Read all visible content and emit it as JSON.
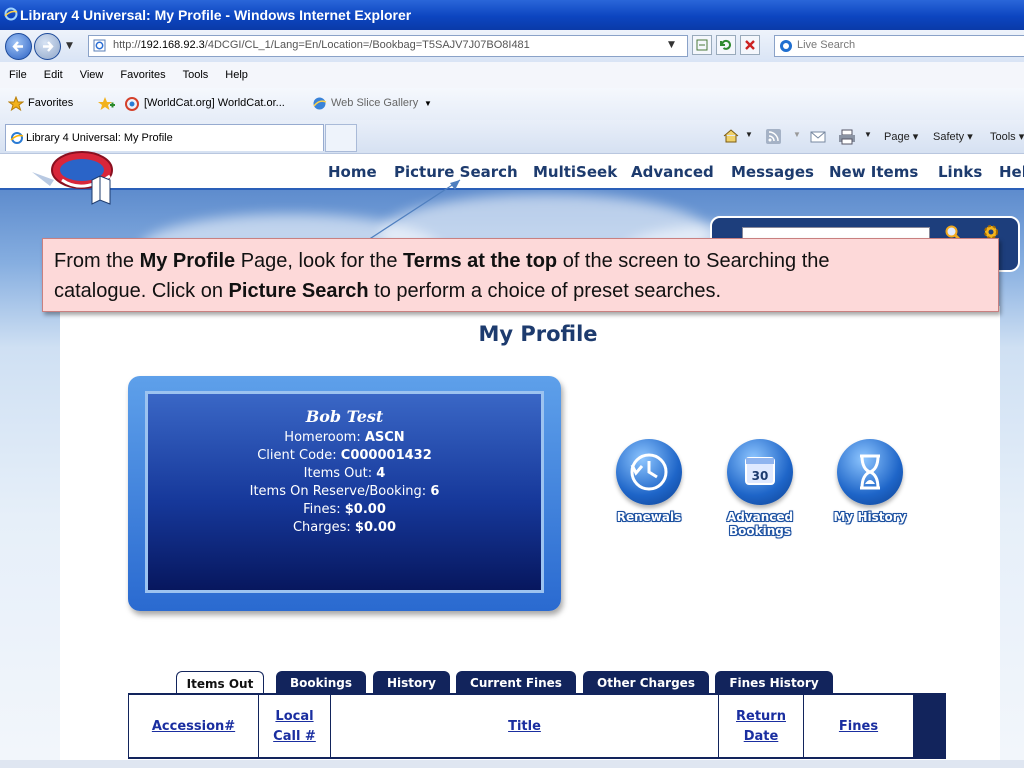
{
  "window": {
    "title": "Library 4 Universal: My Profile - Windows Internet Explorer",
    "url_prefix": "http://",
    "url_host": "192.168.92.3",
    "url_path": "/4DCGI/CL_1/Lang=En/Location=/Bookbag=T5SAJV7J07BO8I481",
    "search_placeholder": "Live Search"
  },
  "menu": [
    "File",
    "Edit",
    "View",
    "Favorites",
    "Tools",
    "Help"
  ],
  "favorites": {
    "favorites_label": "Favorites",
    "worldcat": "[WorldCat.org] WorldCat.or...",
    "slice_gallery": "Web Slice Gallery"
  },
  "browser_tab": {
    "label": "Library 4 Universal: My Profile",
    "commands": {
      "page": "Page",
      "safety": "Safety",
      "tools": "Tools"
    }
  },
  "site_nav": [
    "Home",
    "Picture Search",
    "MultiSeek",
    "Advanced",
    "Messages",
    "New Items",
    "Links",
    "Hel"
  ],
  "callout": {
    "l1_a": "From the ",
    "l1_b": "My Profile",
    "l1_c": " Page, look for  the ",
    "l1_d": "Terms  at the top",
    "l1_e": " of the screen to  Searching the",
    "l2_a": "catalogue.    Click on ",
    "l2_b": "Picture Search",
    "l2_c": " to perform a  choice of preset searches."
  },
  "page_title": "My Profile",
  "profile": {
    "name": "Bob Test",
    "homeroom_label": "Homeroom: ",
    "homeroom": "ASCN",
    "client_label": "Client Code: ",
    "client_code": "C000001432",
    "items_out_label": "Items Out: ",
    "items_out": "4",
    "reserve_label": "Items On Reserve/Booking: ",
    "reserve": "6",
    "fines_label": "Fines: ",
    "fines": "$0.00",
    "charges_label": "Charges: ",
    "charges": "$0.00"
  },
  "actions": {
    "renewals": "Renewals",
    "advanced_1": "Advanced",
    "advanced_2": "Bookings",
    "calendar_day": "30",
    "history": "My History"
  },
  "tabs": [
    "Items Out",
    "Bookings",
    "History",
    "Current Fines",
    "Other Charges",
    "Fines History"
  ],
  "table_headers": {
    "accession": "Accession#",
    "local_1": "Local",
    "local_2": "Call #",
    "title": "Title",
    "return_1": "Return",
    "return_2": "Date",
    "fines": "Fines"
  },
  "colors": {
    "titlebar": "#0c45c0",
    "nav_text": "#1d3b6e",
    "callout_bg": "#fdd9d9",
    "tab_dark": "#12245c",
    "link_blue": "#1a2ea0"
  }
}
